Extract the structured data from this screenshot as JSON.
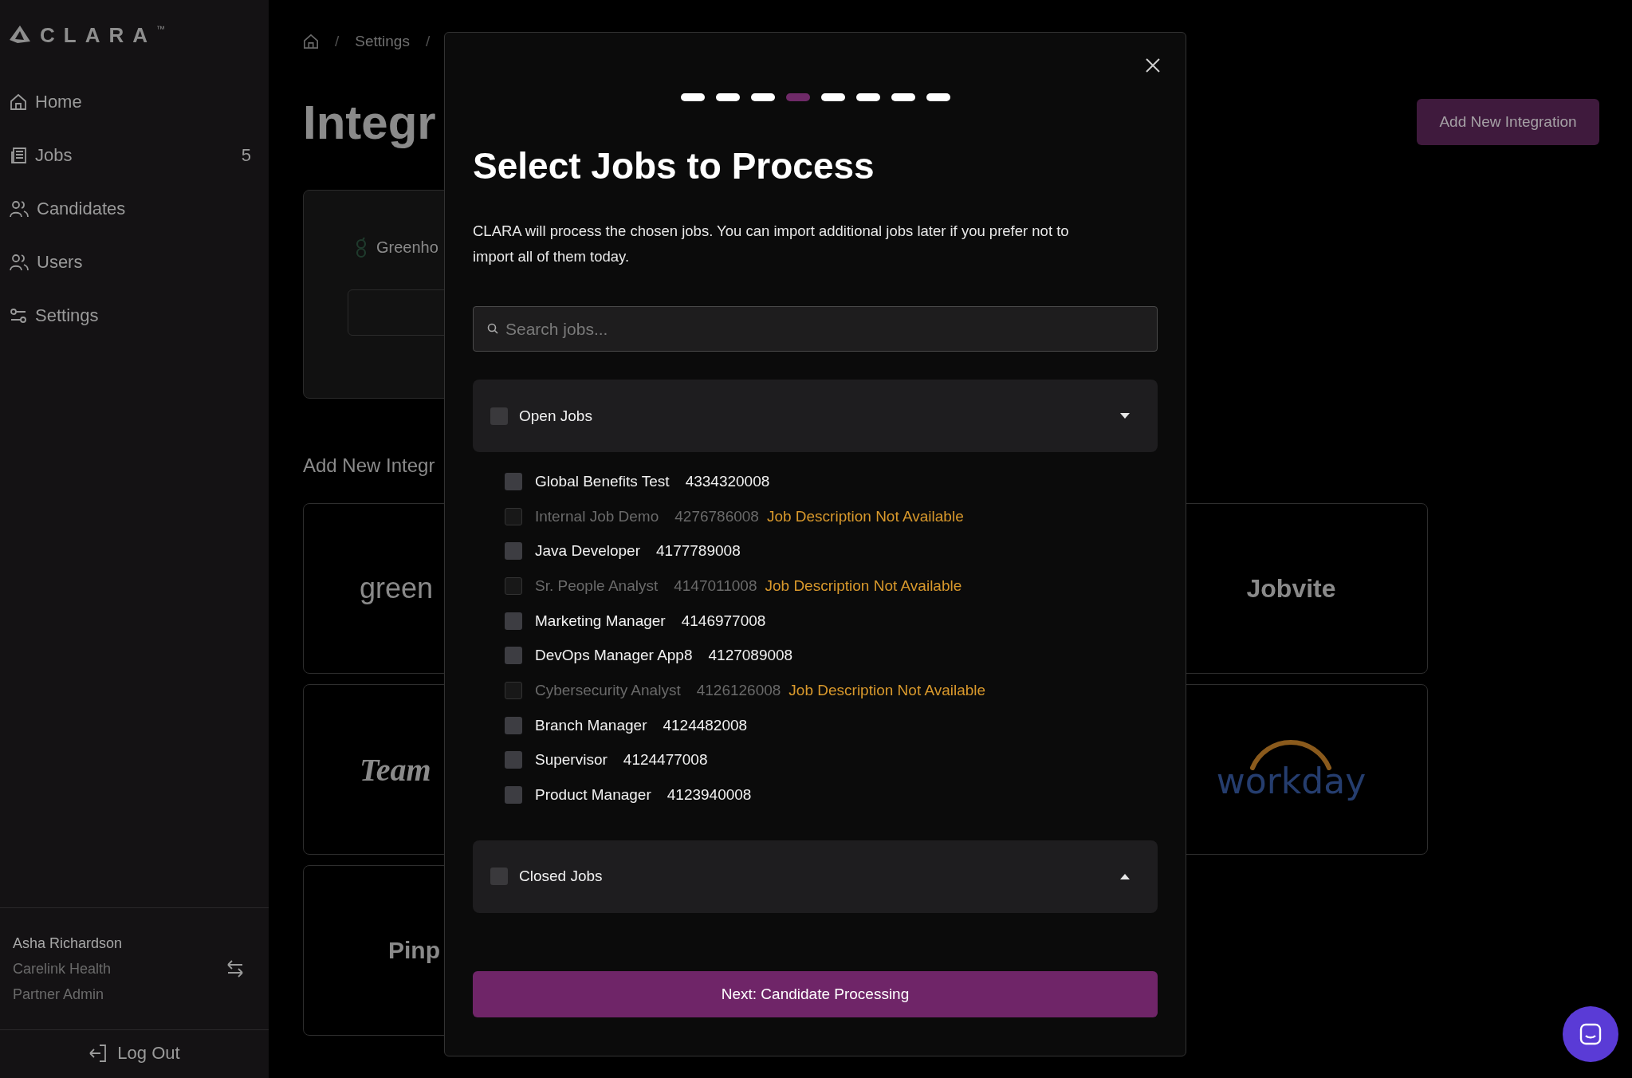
{
  "sidebar": {
    "logo": "CLARA",
    "trademark": "™",
    "nav": [
      {
        "label": "Home"
      },
      {
        "label": "Jobs",
        "count": "5"
      },
      {
        "label": "Candidates"
      },
      {
        "label": "Users"
      },
      {
        "label": "Settings"
      }
    ],
    "user": {
      "name": "Asha Richardson",
      "company": "Carelink Health",
      "role": "Partner Admin"
    },
    "logout": "Log Out"
  },
  "page": {
    "breadcrumb": [
      {
        "kind": "separator",
        "text": "/"
      },
      {
        "kind": "link",
        "text": "Settings"
      },
      {
        "kind": "separator",
        "text": "/"
      }
    ],
    "title": "Integr",
    "add_button": "Add New Integration",
    "current_card": {
      "logo": "Greenho"
    },
    "section_title": "Add New Integr",
    "grid_rows": [
      {
        "left": {
          "logo": "green",
          "kind": "thin"
        },
        "right": {
          "logo": "Jobvite",
          "kind": "bold"
        }
      },
      {
        "left": {
          "logo": "Team",
          "kind": "script"
        },
        "right": {
          "logo": "workday",
          "kind": "workday"
        }
      },
      {
        "left": {
          "logo": "Pinp",
          "kind": "bold"
        }
      }
    ]
  },
  "modal": {
    "steps": [
      {
        "selected": false
      },
      {
        "selected": false
      },
      {
        "selected": false
      },
      {
        "selected": true
      },
      {
        "selected": false
      },
      {
        "selected": false
      },
      {
        "selected": false
      },
      {
        "selected": false
      }
    ],
    "title": "Select Jobs to Process",
    "description": "CLARA will process the chosen jobs. You can import additional jobs later if you prefer not to import all of them today.",
    "search": {
      "placeholder": "Search jobs..."
    },
    "groups": [
      {
        "label": "Open Jobs",
        "checked": false,
        "expanded": true,
        "jobs": [
          {
            "name": "Global Benefits Test",
            "id": "4334320008",
            "checked": false,
            "disabled": false
          },
          {
            "name": "Internal Job Demo",
            "id": "4276786008",
            "checked": false,
            "disabled": true,
            "note": "Job Description Not Available"
          },
          {
            "name": "Java Developer",
            "id": "4177789008",
            "checked": false,
            "disabled": false
          },
          {
            "name": "Sr. People Analyst",
            "id": "4147011008",
            "checked": false,
            "disabled": true,
            "note": "Job Description Not Available"
          },
          {
            "name": "Marketing Manager",
            "id": "4146977008",
            "checked": false,
            "disabled": false
          },
          {
            "name": "DevOps Manager App8",
            "id": "4127089008",
            "checked": false,
            "disabled": false
          },
          {
            "name": "Cybersecurity Analyst",
            "id": "4126126008",
            "checked": false,
            "disabled": true,
            "note": "Job Description Not Available"
          },
          {
            "name": "Branch Manager",
            "id": "4124482008",
            "checked": false,
            "disabled": false
          },
          {
            "name": "Supervisor",
            "id": "4124477008",
            "checked": false,
            "disabled": false
          },
          {
            "name": "Product Manager",
            "id": "4123940008",
            "checked": false,
            "disabled": false
          }
        ]
      },
      {
        "label": "Closed Jobs",
        "checked": false,
        "expanded": false
      }
    ],
    "next_button": "Next: Candidate Processing"
  }
}
